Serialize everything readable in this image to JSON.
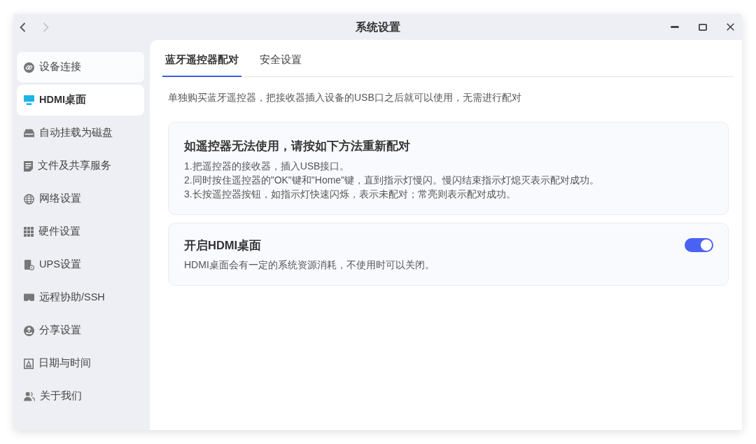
{
  "window": {
    "title": "系统设置"
  },
  "nav_buttons": [
    {
      "kind": "back",
      "disabled": false
    },
    {
      "kind": "forward",
      "disabled": true
    }
  ],
  "sidebar": {
    "items": [
      {
        "label": "设备连接",
        "selected": false,
        "hovered": true
      },
      {
        "label": "HDMI桌面",
        "selected": true,
        "hovered": false
      },
      {
        "label": "自动挂载为磁盘",
        "selected": false,
        "hovered": false
      },
      {
        "label": "文件及共享服务",
        "selected": false,
        "hovered": false
      },
      {
        "label": "网络设置",
        "selected": false,
        "hovered": false
      },
      {
        "label": "硬件设置",
        "selected": false,
        "hovered": false
      },
      {
        "label": "UPS设置",
        "selected": false,
        "hovered": false
      },
      {
        "label": "远程协助/SSH",
        "selected": false,
        "hovered": false
      },
      {
        "label": "分享设置",
        "selected": false,
        "hovered": false
      },
      {
        "label": "日期与时间",
        "selected": false,
        "hovered": false
      },
      {
        "label": "关于我们",
        "selected": false,
        "hovered": false
      }
    ]
  },
  "tabs": [
    {
      "label": "蓝牙遥控器配对",
      "selected": true
    },
    {
      "label": "安全设置",
      "selected": false
    }
  ],
  "intro": "单独购买蓝牙遥控器，把接收器插入设备的USB口之后就可以使用，无需进行配对",
  "cards": [
    {
      "kind": "info",
      "title": "如遥控器无法使用，请按如下方法重新配对",
      "lines": [
        "1.把遥控器的接收器，插入USB接口。",
        "2.同时按住遥控器的\"OK\"键和\"Home\"键，直到指示灯慢闪。慢闪结束指示灯熄灭表示配对成功。",
        "3.长按遥控器按钮，如指示灯快速闪烁，表示未配对；常亮则表示配对成功。"
      ]
    },
    {
      "kind": "switch",
      "title": "开启HDMI桌面",
      "description": "HDMI桌面会有一定的系统资源消耗，不使用时可以关闭。",
      "on": true
    }
  ]
}
